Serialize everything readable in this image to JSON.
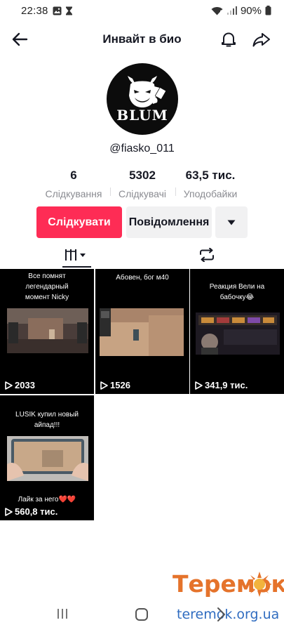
{
  "status_bar": {
    "time": "22:38",
    "battery": "90%",
    "icons": [
      "gallery-icon",
      "hourglass-icon",
      "wifi-icon",
      "signal-icon",
      "battery-icon"
    ]
  },
  "header": {
    "title": "Инвайт в био",
    "back_icon": "back-arrow-icon",
    "bell_icon": "bell-icon",
    "share_icon": "share-icon"
  },
  "profile": {
    "avatar_logo": "BLUM",
    "username": "@fiasko_011"
  },
  "stats": [
    {
      "value": "6",
      "label": "Слідкування"
    },
    {
      "value": "5302",
      "label": "Слідкувачі"
    },
    {
      "value": "63,5 тис.",
      "label": "Уподобайки"
    }
  ],
  "buttons": {
    "follow": "Слідкувати",
    "message": "Повідомлення",
    "more_icon": "caret-down-icon"
  },
  "tabs": {
    "videos_icon": "videos-grid-icon",
    "reposts_icon": "repost-icon"
  },
  "videos": [
    {
      "caption": "Все помнят легендарный момент Nicky",
      "views": "2033"
    },
    {
      "caption": "Абовен, бог м40",
      "views": "1526"
    },
    {
      "caption": "Реакция Вели на бабочку😂",
      "views": "341,9 тис."
    },
    {
      "caption": "LUSIK купил новый айпад!!!",
      "caption2": "Лайк за него❤️❤️",
      "views": "560,8 тис."
    }
  ],
  "watermark": {
    "title": "Теремок",
    "url": "teremok.org.ua"
  },
  "colors": {
    "follow_button": "#fe2c55",
    "secondary_button": "#f1f1f2",
    "text_primary": "#161823",
    "text_secondary": "#8a8b91",
    "watermark_orange": "#e5732b",
    "watermark_blue": "#2f6cc0"
  }
}
